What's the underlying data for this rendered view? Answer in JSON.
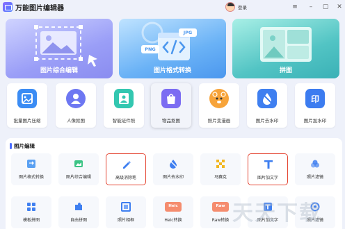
{
  "app": {
    "title": "万能图片编辑器",
    "login": "登录"
  },
  "window_controls": [
    "menu-icon",
    "minimize-icon",
    "maximize-icon",
    "close-icon"
  ],
  "banners": [
    {
      "label": "图片综合编辑",
      "icon": "image-edit-illustration",
      "color": "#8a8cf0"
    },
    {
      "label": "图片格式转换",
      "icon": "format-convert-illustration",
      "tags": [
        "PNG",
        "JPG"
      ],
      "color": "#4b97ee"
    },
    {
      "label": "拼图",
      "icon": "collage-illustration",
      "color": "#3ab1b6"
    }
  ],
  "quick_tools": [
    {
      "label": "批量图片压缩",
      "icon": "compress-icon",
      "color": "#3b8cf4"
    },
    {
      "label": "人像抠图",
      "icon": "portrait-cutout-icon",
      "color": "#6d77f2"
    },
    {
      "label": "智能证件照",
      "icon": "id-photo-icon",
      "color": "#33c7b0"
    },
    {
      "label": "物品抠图",
      "icon": "object-cutout-icon",
      "color": "#7b6cf2"
    },
    {
      "label": "照片变漫画",
      "icon": "cartoon-icon",
      "color": "#f7a43a"
    },
    {
      "label": "图片去水印",
      "icon": "remove-watermark-icon",
      "color": "#3f7ff0"
    },
    {
      "label": "图片加水印",
      "icon": "add-watermark-icon",
      "color": "#3c7cf0"
    }
  ],
  "section": {
    "title": "图片编辑"
  },
  "tools_row1": [
    {
      "label": "图片格式转换",
      "icon": "format-icon",
      "color": "#5aa0f2"
    },
    {
      "label": "图片综合编辑",
      "icon": "edit-image-icon",
      "color": "#3cc486"
    },
    {
      "label": "高级消除笔",
      "icon": "eraser-pen-icon",
      "color": "#3f7ff0"
    },
    {
      "label": "图片去水印",
      "icon": "droplet-icon",
      "color": "#3f7ff0"
    },
    {
      "label": "马赛克",
      "icon": "mosaic-icon",
      "color": "#f2b61f"
    },
    {
      "label": "图片加文字",
      "icon": "text-icon",
      "color": "#3f7ff0"
    },
    {
      "label": "照片滤镜",
      "icon": "filter-icon",
      "color": "#3f7ff0"
    }
  ],
  "tools_row2": [
    {
      "label": "模板拼图",
      "icon": "template-icon",
      "color": "#3f7ff0"
    },
    {
      "label": "自由拼图",
      "icon": "puzzle-icon",
      "color": "#3f7ff0"
    },
    {
      "label": "照片相框",
      "icon": "frame-icon",
      "color": "#3f7ff0"
    },
    {
      "label": "Heic转换",
      "icon": "heic-icon",
      "color": "#f58c6e",
      "badge": "Heic"
    },
    {
      "label": "Raw转换",
      "icon": "raw-icon",
      "color": "#f58c6e",
      "badge": "Raw"
    },
    {
      "label": "图片加文字",
      "icon": "text-icon-2",
      "color": "#3f7ff0"
    },
    {
      "label": "照片滤镜",
      "icon": "filter-icon-2",
      "color": "#3f7ff0"
    }
  ],
  "watermark": "天天下载"
}
